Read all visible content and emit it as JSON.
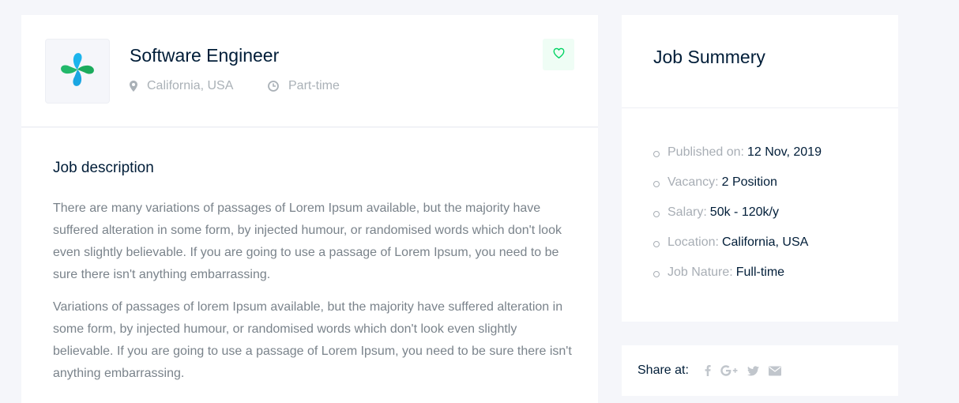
{
  "job": {
    "title": "Software Engineer",
    "location": "California, USA",
    "type": "Part-time"
  },
  "icons": {
    "logo": "clover-logo-icon",
    "location": "map-marker-icon",
    "type": "clock-icon",
    "favorite": "heart-icon"
  },
  "colors": {
    "accent_green": "#00d363",
    "logo_blue": "#1cb4ec",
    "logo_green": "#1bab5c",
    "heading": "#001d38",
    "muted": "#7a838b"
  },
  "description": {
    "title": "Job description",
    "paragraphs": [
      "There are many variations of passages of Lorem Ipsum available, but the majority have suffered alteration in some form, by injected humour, or randomised words which don't look even slightly believable. If you are going to use a passage of Lorem Ipsum, you need to be sure there isn't anything embarrassing.",
      "Variations of passages of lorem Ipsum available, but the majority have suffered alteration in some form, by injected humour, or randomised words which don't look even slightly believable. If you are going to use a passage of Lorem Ipsum, you need to be sure there isn't anything embarrassing."
    ]
  },
  "summary": {
    "title": "Job Summery",
    "items": [
      {
        "label": "Published on:",
        "value": "12 Nov, 2019"
      },
      {
        "label": "Vacancy:",
        "value": "2 Position"
      },
      {
        "label": "Salary:",
        "value": "50k - 120k/y"
      },
      {
        "label": "Location:",
        "value": "California, USA"
      },
      {
        "label": "Job Nature:",
        "value": "Full-time"
      }
    ]
  },
  "share": {
    "label": "Share at:",
    "networks": [
      "facebook-icon",
      "google-plus-icon",
      "twitter-icon",
      "envelope-icon"
    ]
  }
}
